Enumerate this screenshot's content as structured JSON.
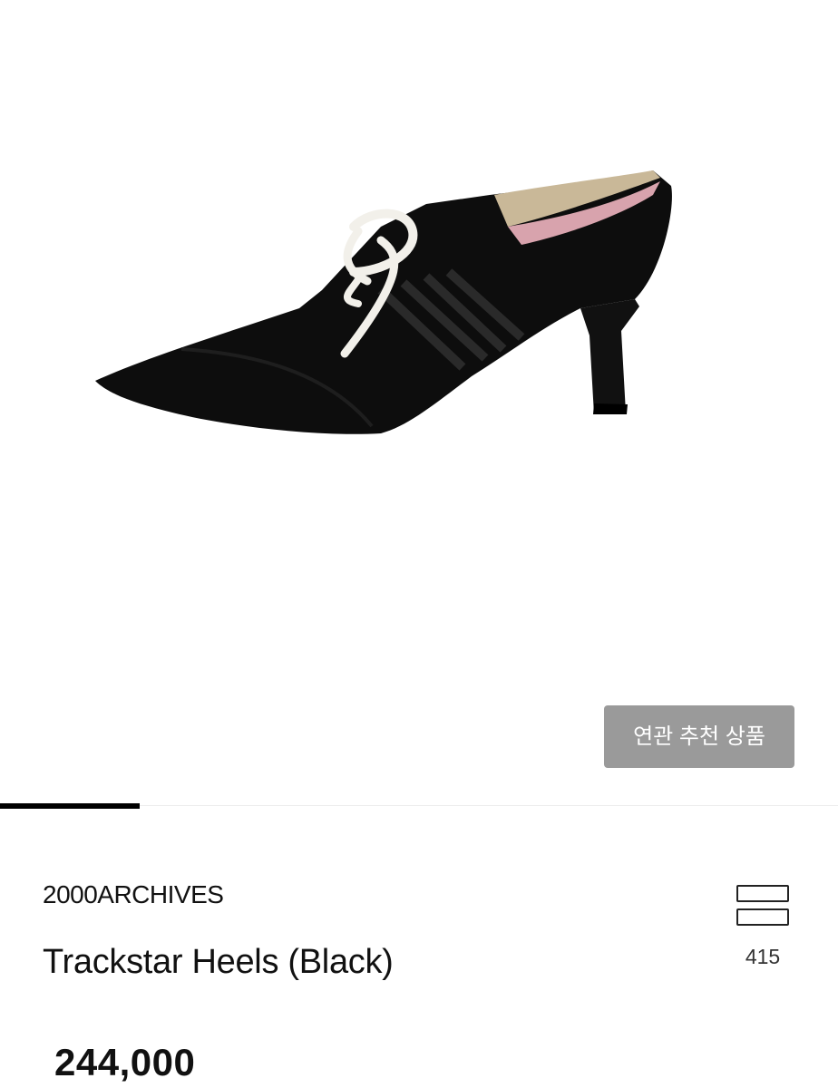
{
  "product": {
    "image_alt": "Trackstar Heels black pointed pump with white laces",
    "brand": "2000ARCHIVES",
    "title": "Trackstar Heels (Black)",
    "price": "244,000"
  },
  "related_button": {
    "label": "연관 추천 상품"
  },
  "wishlist": {
    "icon": "stacked-bars-icon",
    "count": "415"
  },
  "carousel": {
    "current_slide": 1
  },
  "colors": {
    "button_bg": "#9a9a9a",
    "indicator": "#000000",
    "text": "#111111"
  }
}
